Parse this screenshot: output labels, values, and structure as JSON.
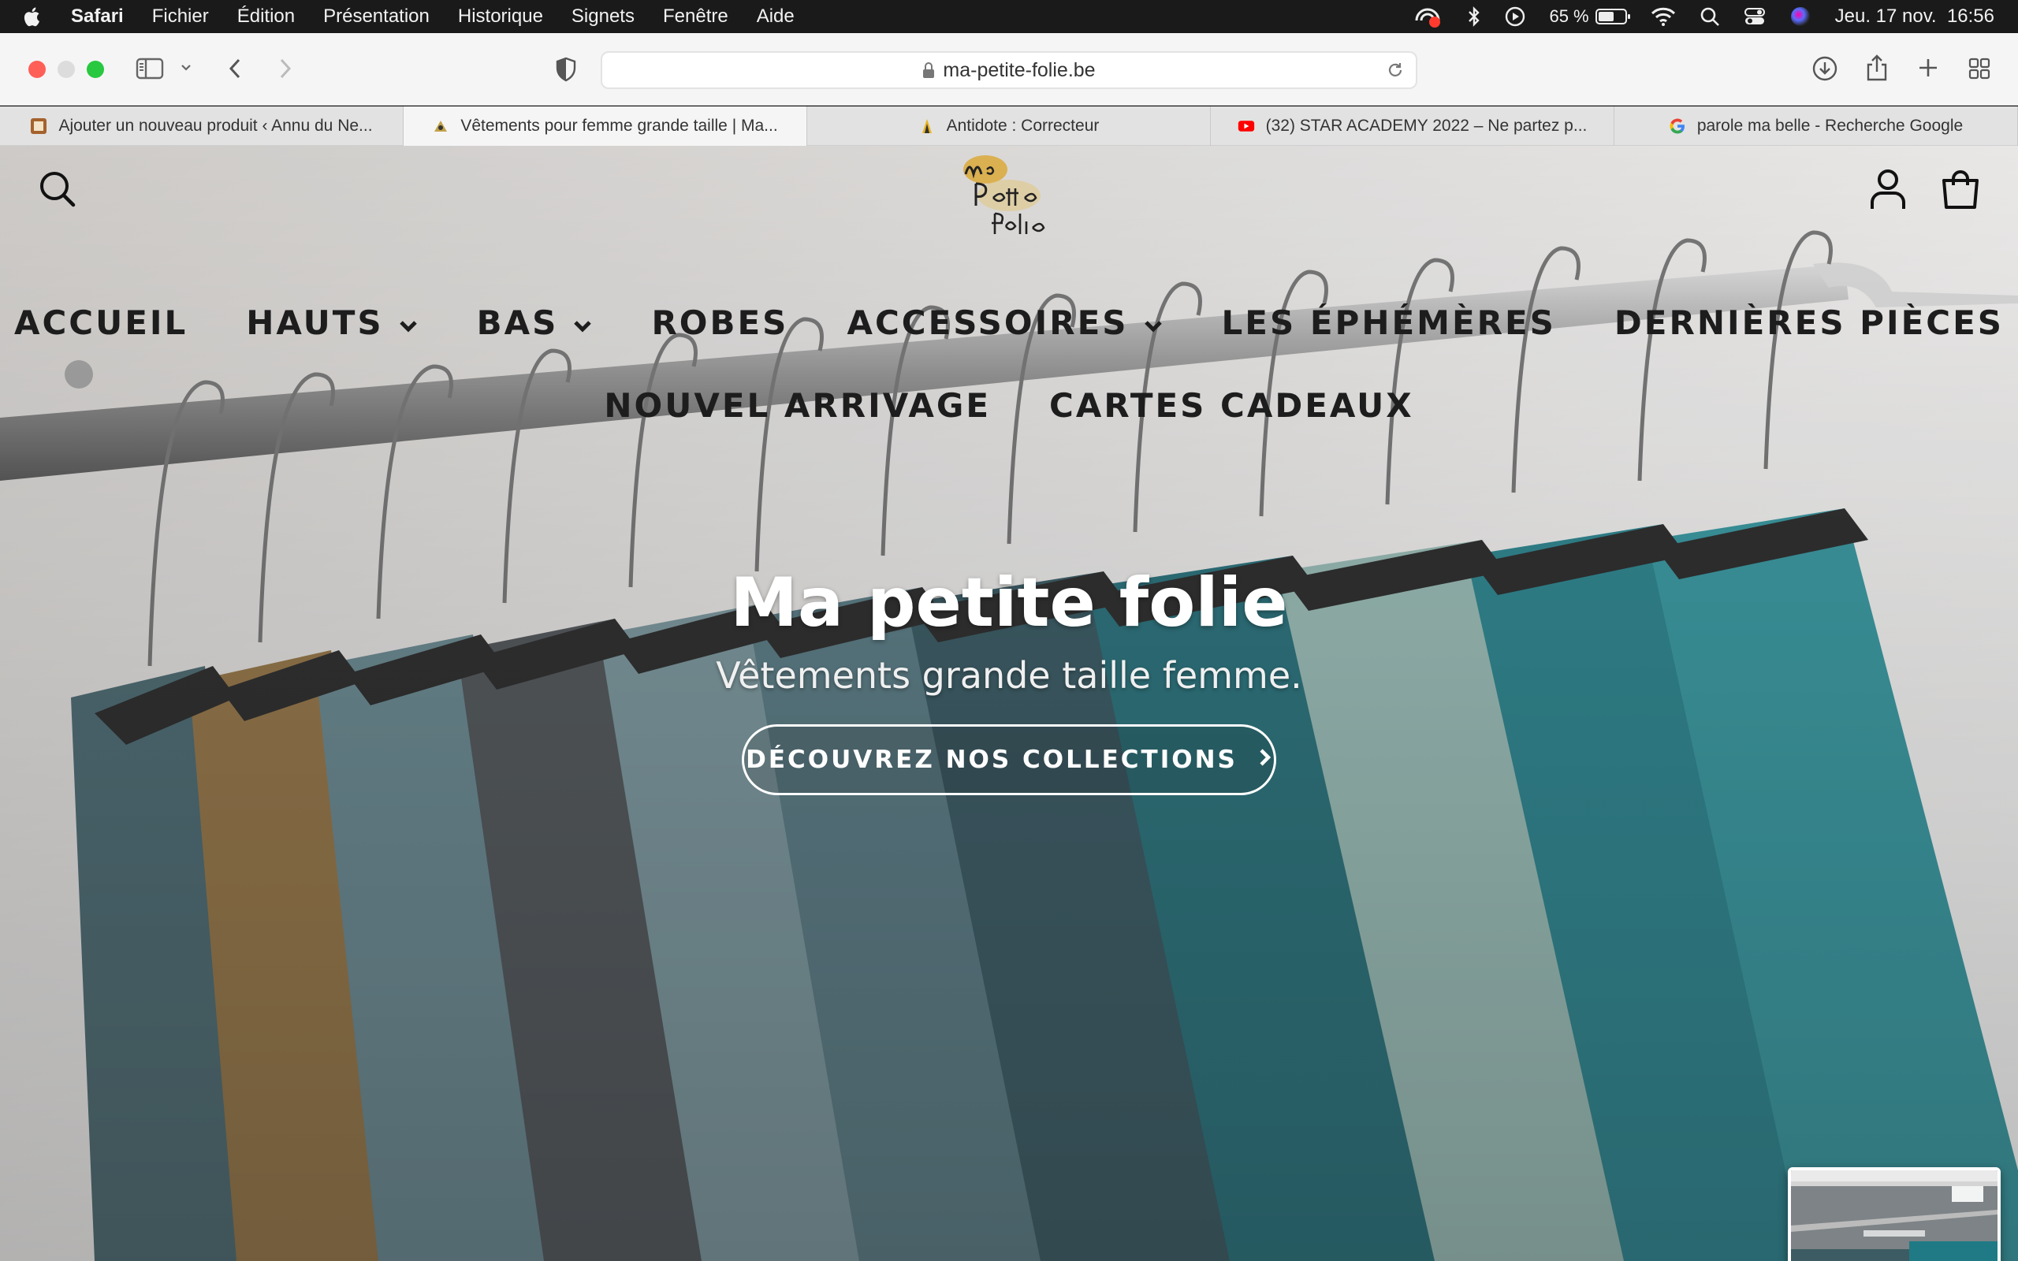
{
  "menubar": {
    "app_name": "Safari",
    "items": [
      "Fichier",
      "Édition",
      "Présentation",
      "Historique",
      "Signets",
      "Fenêtre",
      "Aide"
    ],
    "battery_percent": "65 %",
    "battery_level": 0.65,
    "datetime": "Jeu. 17 nov.  16:56"
  },
  "browser": {
    "url": "ma-petite-folie.be",
    "tabs": [
      {
        "title": "Ajouter un nouveau produit ‹ Annu du Ne...",
        "active": false
      },
      {
        "title": "Vêtements pour femme grande taille | Ma...",
        "active": true
      },
      {
        "title": "Antidote : Correcteur",
        "active": false
      },
      {
        "title": "(32) STAR ACADEMY 2022 – Ne partez p...",
        "active": false
      },
      {
        "title": "parole ma belle - Recherche Google",
        "active": false
      }
    ]
  },
  "site": {
    "logo_text": "Ma Petite Folie",
    "nav_row1": [
      {
        "label": "ACCUEIL",
        "dropdown": false
      },
      {
        "label": "HAUTS",
        "dropdown": true
      },
      {
        "label": "BAS",
        "dropdown": true
      },
      {
        "label": "ROBES",
        "dropdown": false
      },
      {
        "label": "ACCESSOIRES",
        "dropdown": true
      },
      {
        "label": "LES ÉPHÉMÈRES",
        "dropdown": false
      },
      {
        "label": "DERNIÈRES PIÈCES",
        "dropdown": false
      }
    ],
    "nav_row2": [
      {
        "label": "NOUVEL ARRIVAGE",
        "dropdown": false
      },
      {
        "label": "CARTES CADEAUX",
        "dropdown": false
      }
    ],
    "hero_title": "Ma petite folie",
    "hero_subtitle": "Vêtements grande taille femme.",
    "cta_label": "DÉCOUVREZ NOS COLLECTIONS"
  },
  "colors": {
    "traffic_red": "#fe5f57",
    "traffic_yellow": "#dcdcdc",
    "traffic_green": "#28c840",
    "teal_garments": "#1f7a85"
  }
}
